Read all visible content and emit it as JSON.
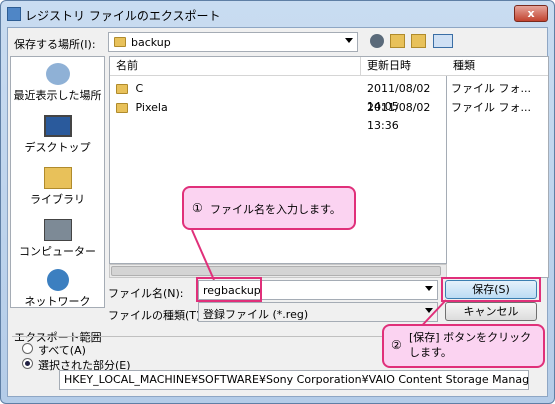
{
  "window": {
    "title": "レジストリ ファイルのエクスポート",
    "close_label": "x"
  },
  "save_in": {
    "label": "保存する場所(I):",
    "value": "backup"
  },
  "places": [
    {
      "label": "最近表示した場所",
      "icon": "recent-places-icon"
    },
    {
      "label": "デスクトップ",
      "icon": "desktop-icon"
    },
    {
      "label": "ライブラリ",
      "icon": "libraries-icon"
    },
    {
      "label": "コンピューター",
      "icon": "computer-icon"
    },
    {
      "label": "ネットワーク",
      "icon": "network-icon"
    }
  ],
  "file_list": {
    "headers": [
      "名前",
      "更新日時",
      "種類"
    ],
    "rows": [
      {
        "name": "C",
        "date": "2011/08/02 14:05",
        "type": "ファイル フォ..."
      },
      {
        "name": "Pixela",
        "date": "2011/08/02 13:36",
        "type": "ファイル フォ..."
      }
    ]
  },
  "file_name": {
    "label": "ファイル名(N):",
    "value": "regbackup"
  },
  "file_type": {
    "label": "ファイルの種類(T):",
    "value": "登録ファイル (*.reg)"
  },
  "buttons": {
    "save": "保存(S)",
    "cancel": "キャンセル"
  },
  "export_range": {
    "label": "エクスポート範囲",
    "all": "すべて(A)",
    "selected": "選択された部分(E)",
    "path": "HKEY_LOCAL_MACHINE¥SOFTWARE¥Sony Corporation¥VAIO Content Storage Manager"
  },
  "callouts": {
    "one_num": "①",
    "one_text": "ファイル名を入力します。",
    "two_num": "②",
    "two_text": "[保存] ボタンをクリックします。"
  },
  "colors": {
    "callout_border": "#e0307a",
    "callout_fill": "#fbd3f1"
  }
}
